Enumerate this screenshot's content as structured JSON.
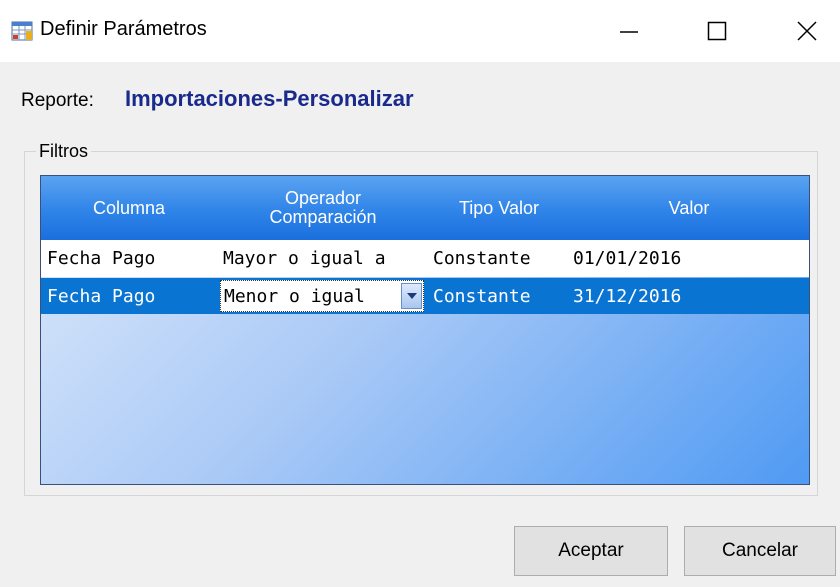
{
  "window": {
    "title": "Definir Parámetros",
    "controls": {
      "minimize": "—",
      "maximize": "☐",
      "close": "✕"
    }
  },
  "reporte": {
    "label": "Reporte:",
    "value": "Importaciones-Personalizar"
  },
  "filtros": {
    "legend": "Filtros",
    "headers": {
      "columna": "Columna",
      "operador_line1": "Operador",
      "operador_line2": "Comparación",
      "tipo": "Tipo Valor",
      "valor": "Valor"
    },
    "rows": [
      {
        "columna": "Fecha Pago",
        "operador": "Mayor o igual a",
        "tipo": "Constante",
        "valor": "01/01/2016"
      },
      {
        "columna": "Fecha Pago",
        "operador": "Menor o igual",
        "tipo": "Constante",
        "valor": "31/12/2016"
      }
    ]
  },
  "buttons": {
    "aceptar": "Aceptar",
    "cancelar": "Cancelar"
  },
  "colors": {
    "reporte_value": "#1a2a8c",
    "header_blue": "#2f84e8",
    "selected_row": "#0a74d2"
  },
  "icons": [
    "app-grid-icon",
    "minimize-icon",
    "maximize-icon",
    "close-icon",
    "dropdown-arrow-icon"
  ]
}
